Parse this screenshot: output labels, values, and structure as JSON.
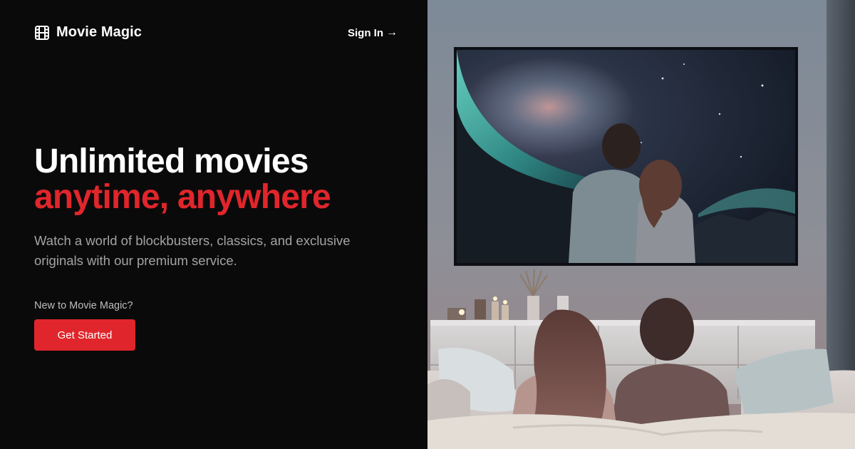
{
  "header": {
    "brand_name": "Movie Magic",
    "brand_icon": "film-icon",
    "sign_in_label": "Sign In",
    "sign_in_arrow": "→"
  },
  "hero": {
    "title_line1": "Unlimited movies",
    "title_line2": "anytime, anywhere",
    "subtitle": "Watch a world of blockbusters, classics, and exclusive originals with our premium service.",
    "new_to_label": "New to Movie Magic?",
    "cta_label": "Get Started"
  },
  "colors": {
    "background": "#0b0a0a",
    "accent": "#e0262c",
    "text": "#ffffff",
    "muted": "#a3a3a3"
  }
}
